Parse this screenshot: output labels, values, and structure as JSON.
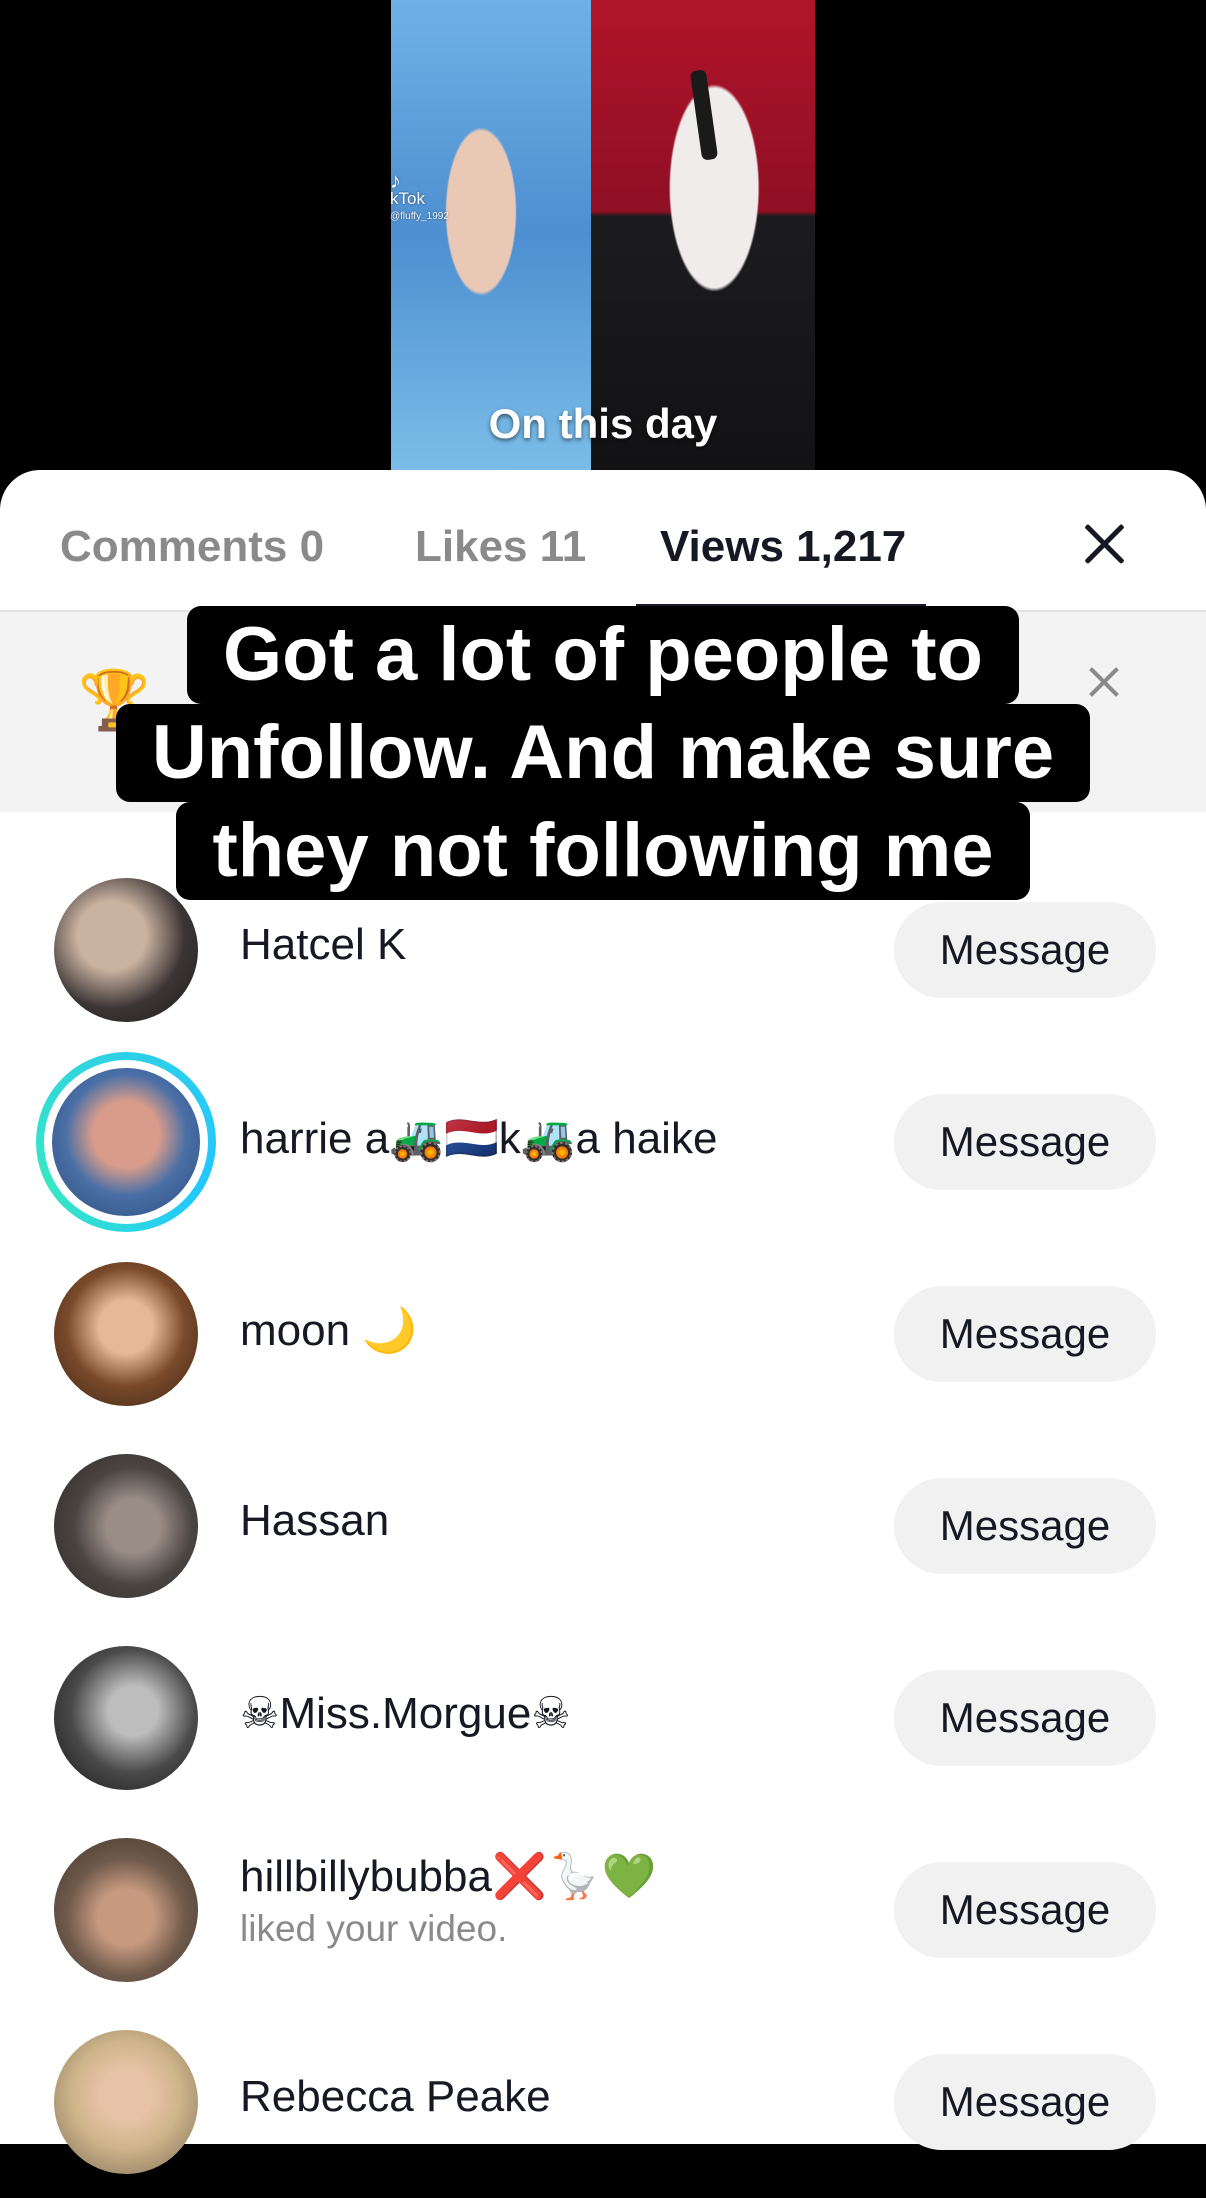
{
  "video": {
    "watermark_brand": "kTok",
    "watermark_handle": "@fluffy_1992",
    "caption": "On this day"
  },
  "tabs": [
    {
      "label": "Comments 0"
    },
    {
      "label": "Likes 11"
    },
    {
      "label": "Views 1,217"
    }
  ],
  "overlay_caption": [
    "Got a lot of people to",
    "Unfollow. And make sure",
    "they not following me"
  ],
  "users": [
    {
      "name": "Hatcel K",
      "button": "Message"
    },
    {
      "name": "harrie a🚜🇳🇱k🚜a haike",
      "button": "Message"
    },
    {
      "name": "moon 🌙",
      "button": "Message"
    },
    {
      "name": "Hassan",
      "button": "Message"
    },
    {
      "name": "☠Miss.Morgue☠",
      "button": "Message"
    },
    {
      "name": "hillbillybubba❌🪿💚",
      "subtext": "liked your video.",
      "button": "Message"
    },
    {
      "name": "Rebecca Peake",
      "button": "Message"
    }
  ],
  "colors": {
    "text_primary": "#161823",
    "text_secondary": "#8a8a8a",
    "story_ring": "#2ed0e7",
    "button_bg": "#f1f1f2"
  }
}
